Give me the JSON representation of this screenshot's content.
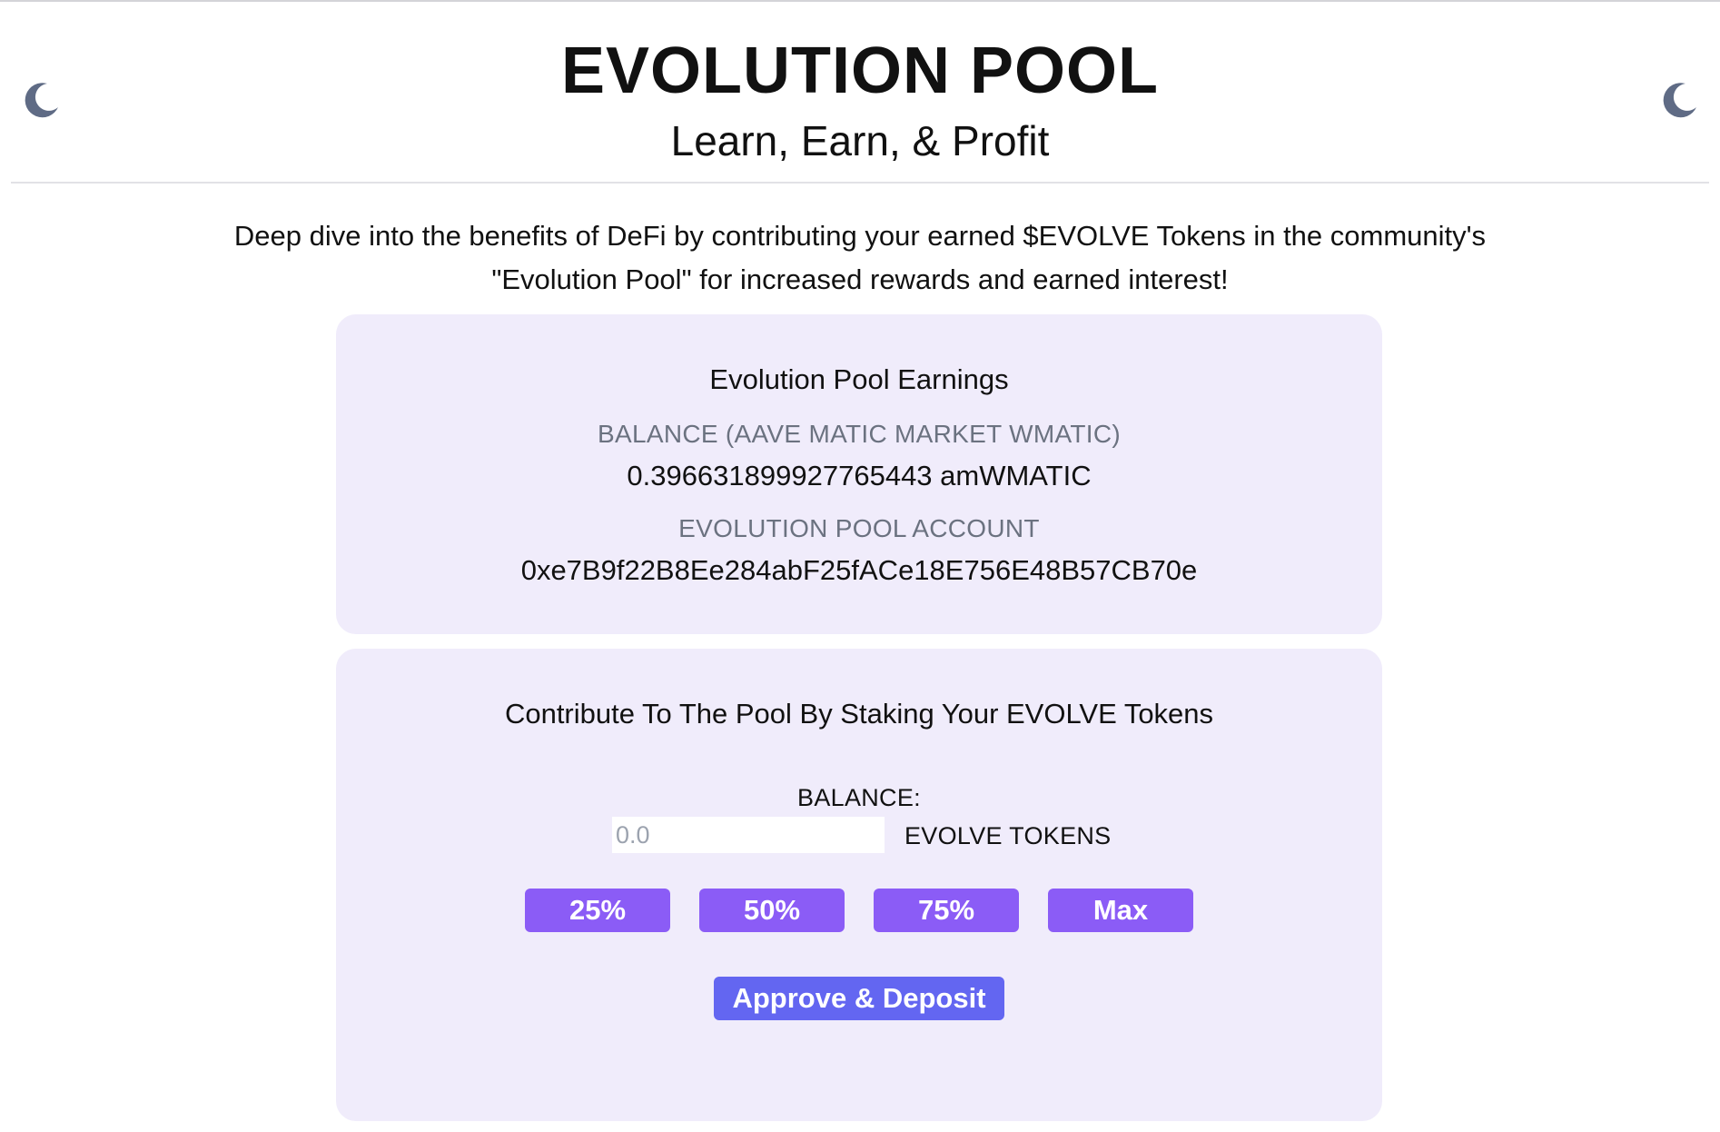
{
  "header": {
    "title": "EVOLUTION POOL",
    "subtitle": "Learn, Earn, & Profit",
    "theme_toggle_icon": "moon-icon",
    "moon_color": "#5f6b85"
  },
  "intro": {
    "line1": "Deep dive into the benefits of DeFi by contributing your earned $EVOLVE Tokens in the community's",
    "line2": "\"Evolution Pool\" for increased rewards and earned interest!"
  },
  "earnings": {
    "title": "Evolution Pool Earnings",
    "balance_label": "BALANCE (AAVE MATIC MARKET WMATIC)",
    "balance_value": "0.396631899927765443 amWMATIC",
    "account_label": "EVOLUTION POOL ACCOUNT",
    "account_value": "0xe7B9f22B8Ee284abF25fACe18E756E48B57CB70e"
  },
  "stake": {
    "title": "Contribute To The Pool By Staking Your EVOLVE Tokens",
    "balance_label": "BALANCE:",
    "input_value": "",
    "input_placeholder": "0.0",
    "unit_label": "EVOLVE TOKENS",
    "percent_buttons": [
      "25%",
      "50%",
      "75%",
      "Max"
    ],
    "deposit_label": "Approve & Deposit"
  },
  "colors": {
    "card_background": "#f0ecfb",
    "percent_button": "#8b5cf6",
    "deposit_button": "#6366f1"
  }
}
